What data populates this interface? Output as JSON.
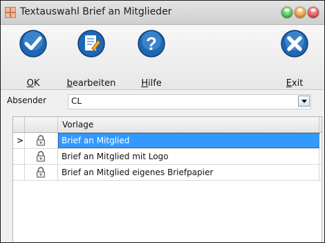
{
  "window": {
    "title": "Textauswahl Brief an Mitglieder"
  },
  "toolbar": {
    "buttons": [
      {
        "label": "OK",
        "mnemonic": "O",
        "rest": "K",
        "icon": "check-icon"
      },
      {
        "label": "bearbeiten",
        "mnemonic": "b",
        "rest": "earbeiten",
        "icon": "edit-document-icon"
      },
      {
        "label": "Hilfe",
        "mnemonic": "H",
        "rest": "ilfe",
        "icon": "help-icon"
      },
      {
        "label": "Exit",
        "mnemonic": "E",
        "rest": "xit",
        "icon": "close-icon"
      }
    ]
  },
  "sender": {
    "label": "Absender",
    "value": "CL"
  },
  "grid": {
    "columns": [
      "",
      "",
      "Vorlage"
    ],
    "rows": [
      {
        "name": "Brief an Mitglied",
        "selected": true,
        "icon": "lock-icon"
      },
      {
        "name": "Brief an Mitglied mit Logo",
        "selected": false,
        "icon": "lock-icon"
      },
      {
        "name": "Brief an Mitglied eigenes Briefpapier",
        "selected": false,
        "icon": "lock-icon"
      }
    ]
  },
  "colors": {
    "accent": "#1e6fbf",
    "selection": "#3399ff",
    "dot_green": "#3cbf3c",
    "dot_orange": "#f0a030",
    "dot_red": "#e55050"
  }
}
